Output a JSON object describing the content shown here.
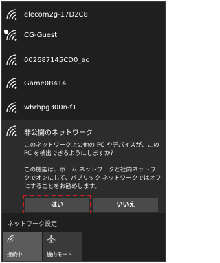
{
  "networks": [
    {
      "name": "elecom2g-17D2C8",
      "secured": false
    },
    {
      "name": "CG-Guest",
      "secured": true
    },
    {
      "name": "002687145CD0_ac",
      "secured": false
    },
    {
      "name": "Game08414",
      "secured": false
    },
    {
      "name": "whrhpg300n-f1",
      "secured": false
    }
  ],
  "expanded": {
    "name": "非公開のネットワーク",
    "question": "このネットワーク上の他の PC やデバイスが、この PC を検出できるようにしますか?",
    "info": "この機能は、ホーム ネットワークと社内ネットワークでオンにして、パブリック ネットワークではオフにすることをお勧めします。",
    "yes_label": "はい",
    "no_label": "いいえ"
  },
  "settings_label": "ネットワーク設定",
  "tiles": [
    {
      "label": "接続中",
      "icon": "wifi-icon"
    },
    {
      "label": "機内モード",
      "icon": "airplane-icon"
    }
  ],
  "colors": {
    "panel": "#1f1f1f",
    "expanded_bg": "#2c2c2c",
    "button": "#4a4a4a",
    "highlight_frame": "#d41f1f",
    "tile_active": "#5a5a5a",
    "tile_inactive": "#3a3a3a"
  }
}
